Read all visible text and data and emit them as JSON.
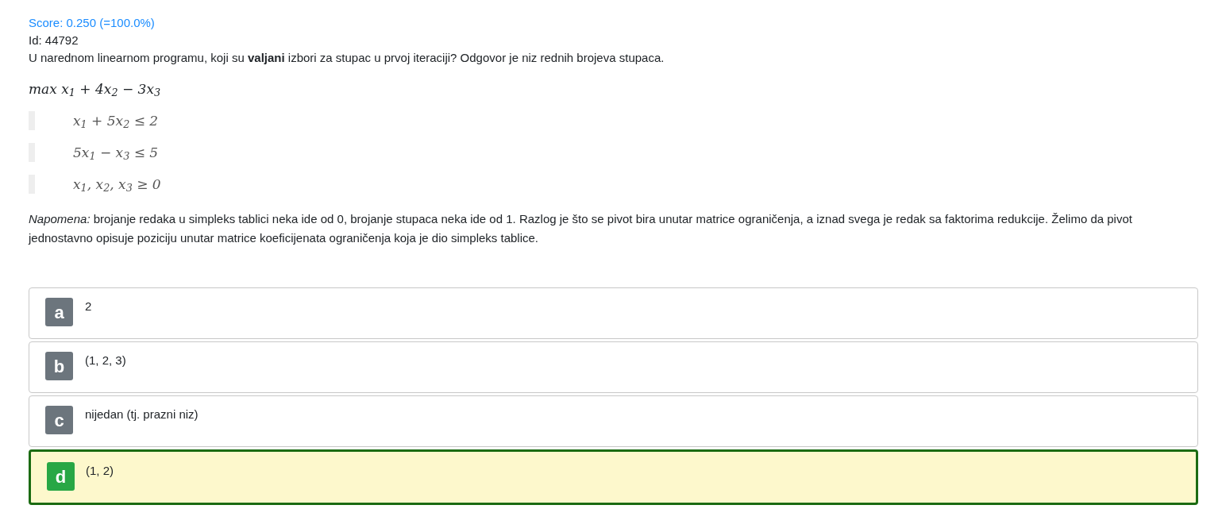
{
  "score": "Score: 0.250 (=100.0%)",
  "id": "Id: 44792",
  "question": "U narednom linearnom programu, koji su **valjani** izbori za stupac u prvoj iteraciji? Odgovor je niz rednih brojeva stupaca.",
  "objective": "max x$_{1}$ + 4x$_{2}$ − 3x$_{3}$",
  "constraints": [
    "x$_{1}$ + 5x$_{2}$ ≤ 2",
    "5x$_{1}$ − x$_{3}$ ≤ 5",
    "x$_{1}$, x$_{2}$, x$_{3}$ ≥ 0"
  ],
  "note": "*Napomena:* brojanje redaka u simpleks tablici neka ide od 0, brojanje stupaca neka ide od 1. Razlog je što se pivot bira unutar matrice ograničenja, a iznad svega je redak sa faktorima redukcije. Želimo da pivot jednostavno opisuje poziciju unutar matrice koeficijenata ograničenja koja je dio simpleks tablice.",
  "options": [
    {
      "letter": "a",
      "text": "2",
      "selected": false
    },
    {
      "letter": "b",
      "text": "(1, 2, 3)",
      "selected": false
    },
    {
      "letter": "c",
      "text": "nijedan (tj. prazni niz)",
      "selected": false
    },
    {
      "letter": "d",
      "text": "(1, 2)",
      "selected": true
    }
  ]
}
